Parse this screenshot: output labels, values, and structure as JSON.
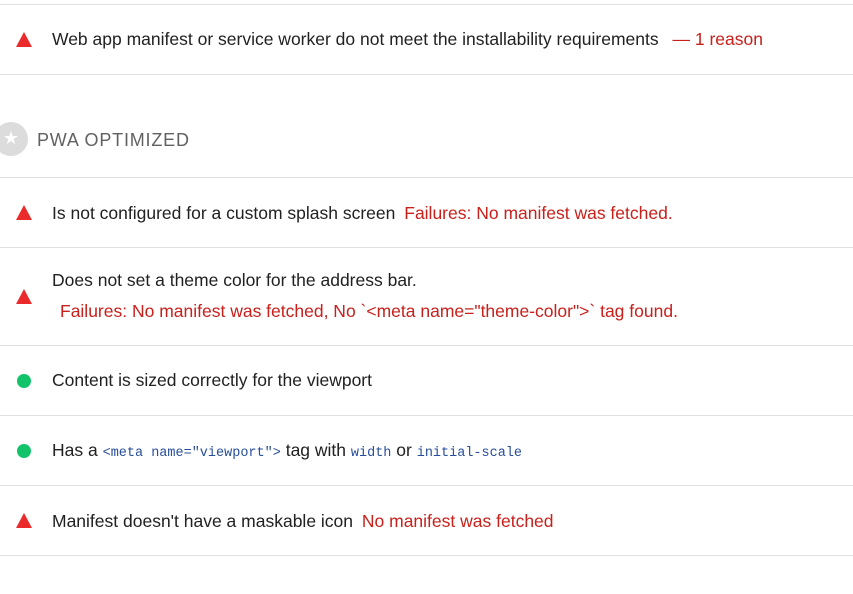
{
  "colors": {
    "fail": "#eb2b2b",
    "fail_text": "#c8201b",
    "pass": "#12c36a",
    "divider": "#e0e0e0",
    "code": "#274e9a"
  },
  "top_audit": {
    "title": "Web app manifest or service worker do not meet the installability requirements",
    "reason": "— 1 reason",
    "status": "fail"
  },
  "group": {
    "icon": "star-icon",
    "title": "PWA OPTIMIZED"
  },
  "audits": [
    {
      "title": "Is not configured for a custom splash screen",
      "detail": "Failures: No manifest was fetched.",
      "status": "fail"
    },
    {
      "title": "Does not set a theme color for the address bar.",
      "detail": "Failures: No manifest was fetched, No `<meta name=\"theme-color\">` tag found.",
      "status": "fail"
    },
    {
      "title": "Content is sized correctly for the viewport",
      "status": "pass"
    },
    {
      "title_prefix": "Has a",
      "code1": "<meta name=\"viewport\">",
      "mid": "tag with",
      "code2": "width",
      "or": "or",
      "code3": "initial-scale",
      "status": "pass"
    },
    {
      "title": "Manifest doesn't have a maskable icon",
      "detail": "No manifest was fetched",
      "status": "fail"
    }
  ]
}
